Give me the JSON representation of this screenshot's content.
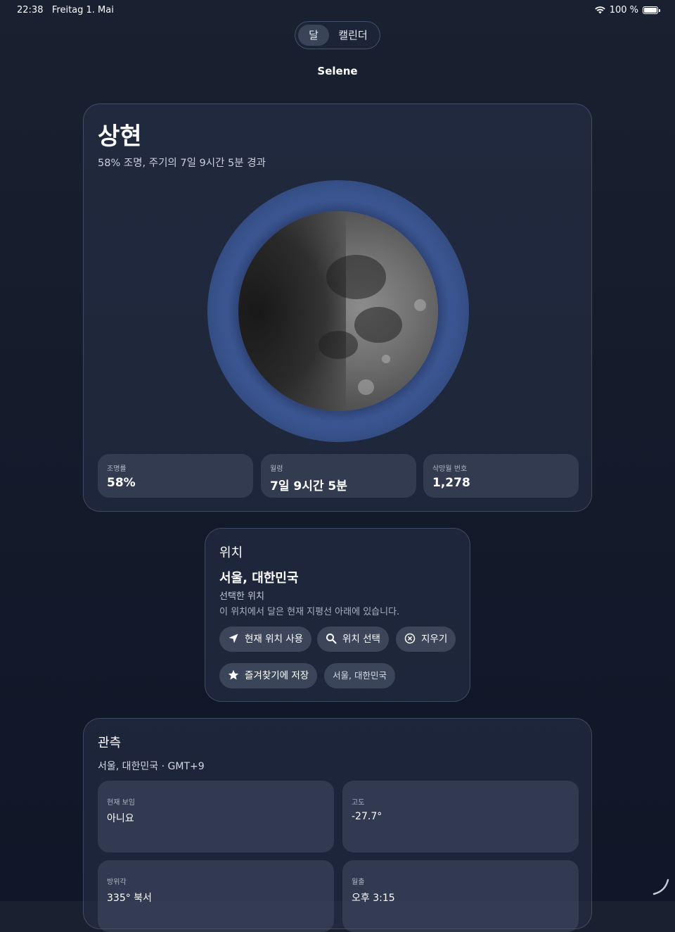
{
  "status_bar": {
    "time": "22:38",
    "date": "Freitag 1. Mai",
    "battery": "100 %"
  },
  "segmented": {
    "items": [
      "달",
      "캘린더"
    ],
    "selected": "달"
  },
  "app_title": "Selene",
  "moon_card": {
    "phase": "상현",
    "summary": "58% 조명, 주기의 7일 9시간 5분 경과",
    "illumination_fraction": 0.58,
    "stats": [
      {
        "label": "조명률",
        "value": "58%"
      },
      {
        "label": "월령",
        "value": "7일 9시간 5분"
      },
      {
        "label": "삭망월 번호",
        "value": "1,278"
      }
    ]
  },
  "location_card": {
    "title": "위치",
    "city": "서울, 대한민국",
    "selected_label": "선택한 위치",
    "note": "이 위치에서 달은 현재 지평선 아래에 있습니다.",
    "buttons": {
      "use_current": "현재 위치 사용",
      "choose": "위치 선택",
      "clear": "지우기",
      "save_favorite": "즐겨찾기에 저장"
    },
    "favorite_chip": "서울, 대한민국"
  },
  "observation_card": {
    "title": "관측",
    "subtitle": "서울, 대한민국 · GMT+9",
    "cells": [
      {
        "label": "현재 보임",
        "value": "아니요"
      },
      {
        "label": "고도",
        "value": "-27.7°"
      },
      {
        "label": "방위각",
        "value": "335° 북서"
      },
      {
        "label": "월출",
        "value": "오후 3:15"
      }
    ]
  },
  "colors": {
    "background": "#141b2b",
    "card": "#28324a",
    "halo": "#415fa0"
  }
}
